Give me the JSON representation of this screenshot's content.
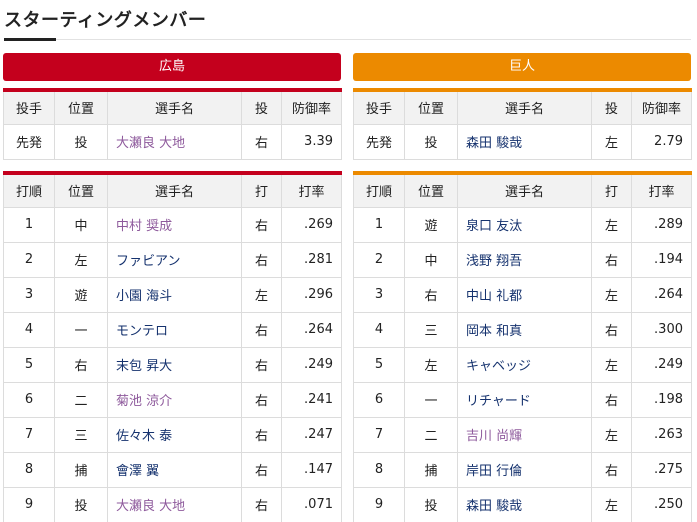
{
  "page": {
    "title": "スターティングメンバー"
  },
  "colors": {
    "home": "#c4001d",
    "away": "#ec8a00",
    "link": "#15326e",
    "visited": "#8e5a9c"
  },
  "pitcher_headers": [
    "投手",
    "位置",
    "選手名",
    "投",
    "防御率"
  ],
  "lineup_headers": [
    "打順",
    "位置",
    "選手名",
    "打",
    "打率"
  ],
  "home": {
    "team": "広島",
    "pitcher": {
      "role": "先発",
      "pos": "投",
      "name": "大瀬良 大地",
      "hand": "右",
      "era": "3.39"
    },
    "lineup": [
      {
        "order": "1",
        "pos": "中",
        "name": "中村 奨成",
        "bat": "右",
        "avg": ".269",
        "visited": true
      },
      {
        "order": "2",
        "pos": "左",
        "name": "ファビアン",
        "bat": "右",
        "avg": ".281",
        "visited": false
      },
      {
        "order": "3",
        "pos": "遊",
        "name": "小園 海斗",
        "bat": "左",
        "avg": ".296",
        "visited": false
      },
      {
        "order": "4",
        "pos": "一",
        "name": "モンテロ",
        "bat": "右",
        "avg": ".264",
        "visited": false
      },
      {
        "order": "5",
        "pos": "右",
        "name": "末包 昇大",
        "bat": "右",
        "avg": ".249",
        "visited": false
      },
      {
        "order": "6",
        "pos": "二",
        "name": "菊池 涼介",
        "bat": "右",
        "avg": ".241",
        "visited": true
      },
      {
        "order": "7",
        "pos": "三",
        "name": "佐々木 泰",
        "bat": "右",
        "avg": ".247",
        "visited": false
      },
      {
        "order": "8",
        "pos": "捕",
        "name": "會澤 翼",
        "bat": "右",
        "avg": ".147",
        "visited": false
      },
      {
        "order": "9",
        "pos": "投",
        "name": "大瀬良 大地",
        "bat": "右",
        "avg": ".071",
        "visited": true
      }
    ]
  },
  "away": {
    "team": "巨人",
    "pitcher": {
      "role": "先発",
      "pos": "投",
      "name": "森田 駿哉",
      "hand": "左",
      "era": "2.79"
    },
    "lineup": [
      {
        "order": "1",
        "pos": "遊",
        "name": "泉口 友汰",
        "bat": "左",
        "avg": ".289",
        "visited": false
      },
      {
        "order": "2",
        "pos": "中",
        "name": "浅野 翔吾",
        "bat": "右",
        "avg": ".194",
        "visited": false
      },
      {
        "order": "3",
        "pos": "右",
        "name": "中山 礼都",
        "bat": "左",
        "avg": ".264",
        "visited": false
      },
      {
        "order": "4",
        "pos": "三",
        "name": "岡本 和真",
        "bat": "右",
        "avg": ".300",
        "visited": false
      },
      {
        "order": "5",
        "pos": "左",
        "name": "キャベッジ",
        "bat": "左",
        "avg": ".249",
        "visited": false
      },
      {
        "order": "6",
        "pos": "一",
        "name": "リチャード",
        "bat": "右",
        "avg": ".198",
        "visited": false
      },
      {
        "order": "7",
        "pos": "二",
        "name": "吉川 尚輝",
        "bat": "左",
        "avg": ".263",
        "visited": true
      },
      {
        "order": "8",
        "pos": "捕",
        "name": "岸田 行倫",
        "bat": "右",
        "avg": ".275",
        "visited": false
      },
      {
        "order": "9",
        "pos": "投",
        "name": "森田 駿哉",
        "bat": "左",
        "avg": ".250",
        "visited": false
      }
    ]
  }
}
